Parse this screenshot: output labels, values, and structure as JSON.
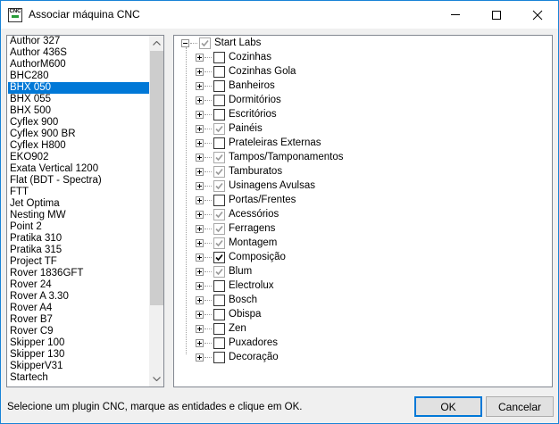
{
  "window": {
    "title": "Associar máquina CNC",
    "icon_text": "CNC"
  },
  "machines": {
    "selected_index": 4,
    "items": [
      "Author 327",
      "Author 436S",
      "AuthorM600",
      "BHC280",
      "BHX 050",
      "BHX 055",
      "BHX 500",
      "Cyflex 900",
      "Cyflex 900 BR",
      "Cyflex H800",
      "EKO902",
      "Exata Vertical 1200",
      "Flat (BDT - Spectra)",
      "FTT",
      "Jet Optima",
      "Nesting MW",
      "Point 2",
      "Pratika 310",
      "Pratika 315",
      "Project TF",
      "Rover 1836GFT",
      "Rover 24",
      "Rover A 3.30",
      "Rover A4",
      "Rover B7",
      "Rover C9",
      "Skipper 100",
      "Skipper 130",
      "SkipperV31",
      "Startech"
    ]
  },
  "tree": {
    "root": {
      "label": "Start Labs",
      "state": "gray-check",
      "expanded": true
    },
    "children": [
      {
        "label": "Cozinhas",
        "state": "unchecked"
      },
      {
        "label": "Cozinhas Gola",
        "state": "unchecked"
      },
      {
        "label": "Banheiros",
        "state": "unchecked"
      },
      {
        "label": "Dormitórios",
        "state": "unchecked"
      },
      {
        "label": "Escritórios",
        "state": "unchecked"
      },
      {
        "label": "Painéis",
        "state": "gray-check"
      },
      {
        "label": "Prateleiras Externas",
        "state": "unchecked"
      },
      {
        "label": "Tampos/Tamponamentos",
        "state": "gray-check"
      },
      {
        "label": "Tamburatos",
        "state": "gray-check"
      },
      {
        "label": "Usinagens Avulsas",
        "state": "gray-check"
      },
      {
        "label": "Portas/Frentes",
        "state": "unchecked"
      },
      {
        "label": "Acessórios",
        "state": "gray-check"
      },
      {
        "label": "Ferragens",
        "state": "gray-check"
      },
      {
        "label": "Montagem",
        "state": "gray-check"
      },
      {
        "label": "Composição",
        "state": "checked"
      },
      {
        "label": "Blum",
        "state": "gray-check"
      },
      {
        "label": "Electrolux",
        "state": "unchecked"
      },
      {
        "label": "Bosch",
        "state": "unchecked"
      },
      {
        "label": "Obispa",
        "state": "unchecked"
      },
      {
        "label": "Zen",
        "state": "unchecked"
      },
      {
        "label": "Puxadores",
        "state": "unchecked"
      },
      {
        "label": "Decoração",
        "state": "unchecked"
      }
    ]
  },
  "footer": {
    "status_text": "Selecione um plugin CNC, marque as entidades e clique em OK.",
    "ok_label": "OK",
    "cancel_label": "Cancelar"
  },
  "colors": {
    "selection": "#0078d7",
    "window_border": "#1883d7",
    "gray_check": "#9a9a9a"
  }
}
